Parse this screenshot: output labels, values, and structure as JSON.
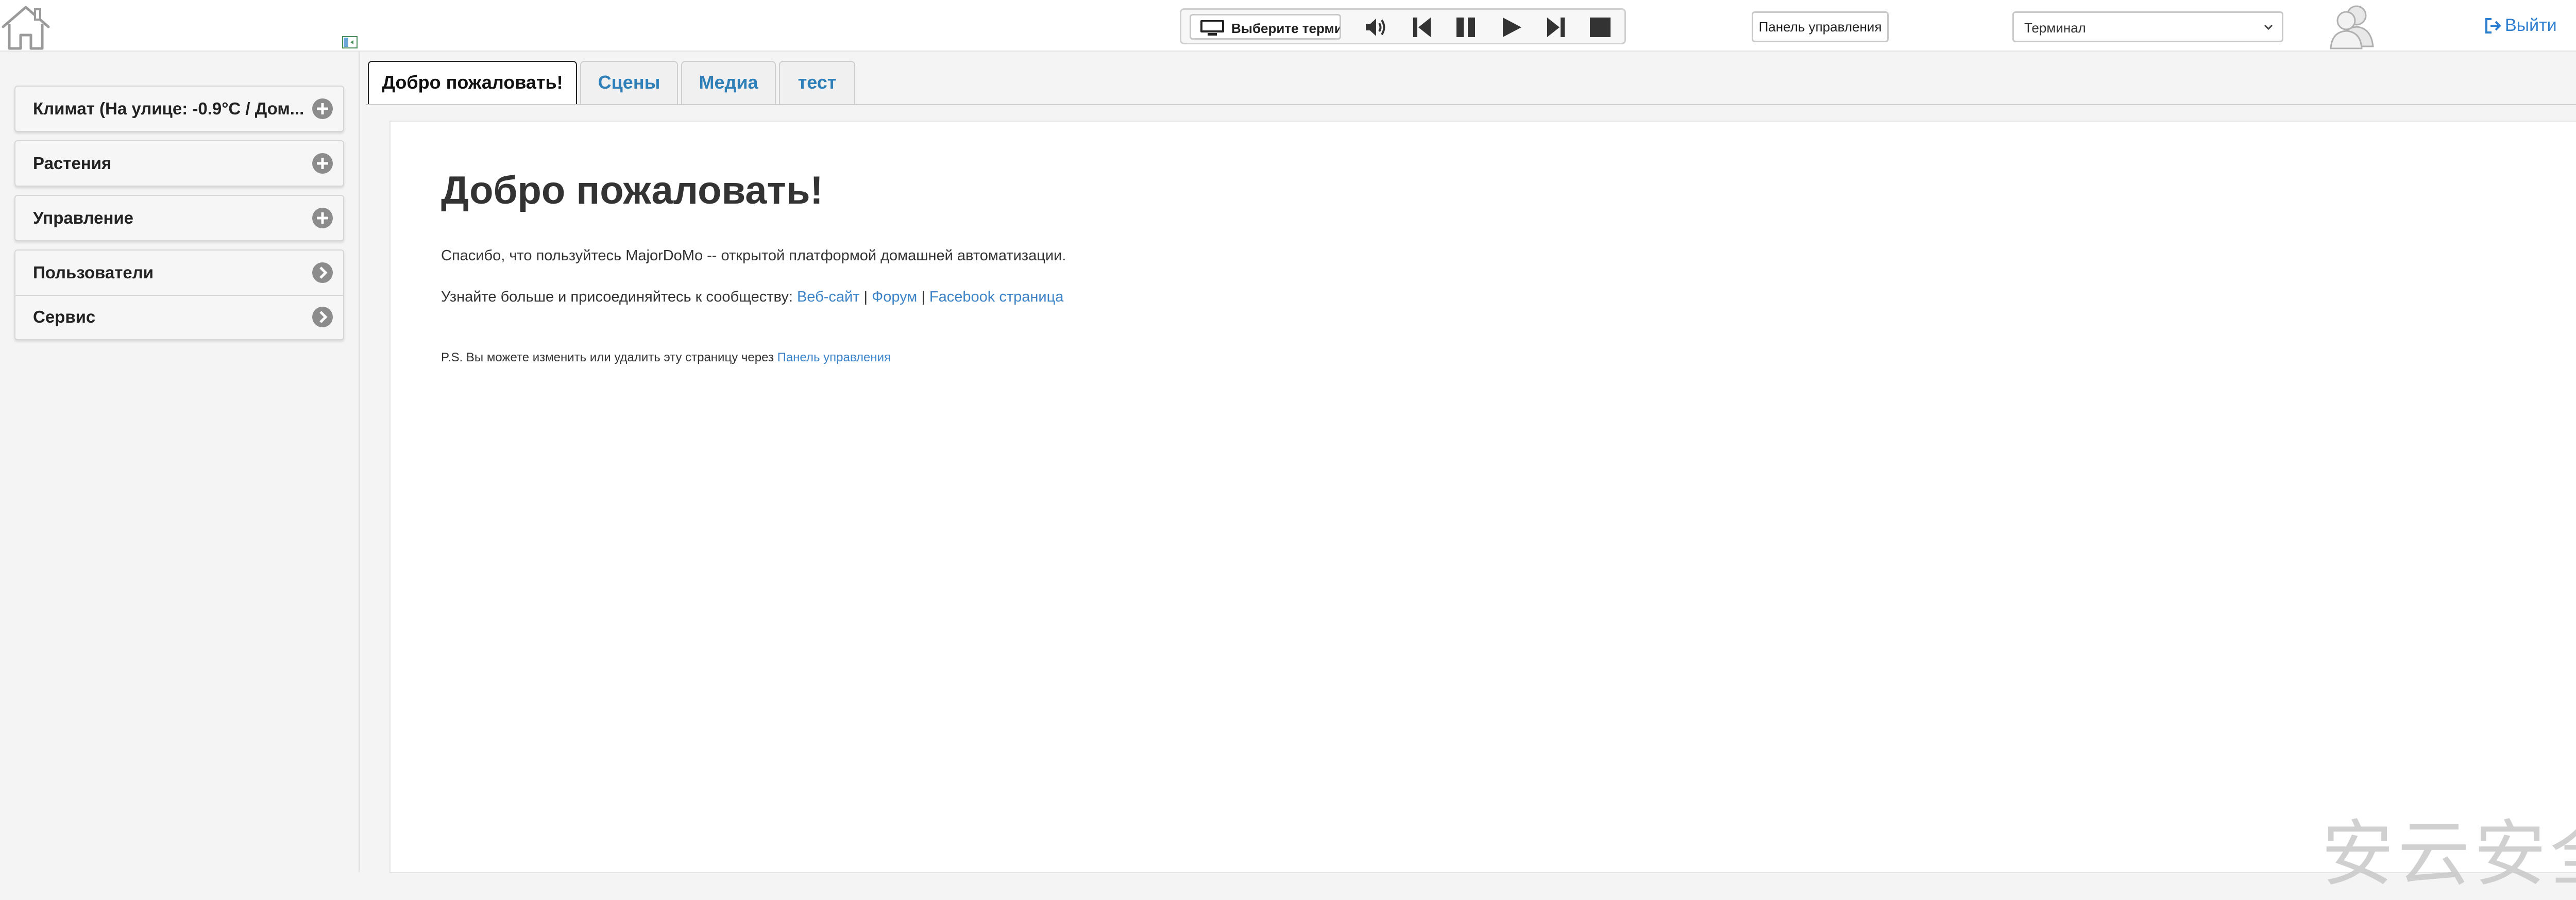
{
  "header": {
    "home_icon": "home-outline-icon",
    "sidebar_toggle_icon": "sidebar-toggle-icon",
    "player": {
      "terminal_button_label": "Выберите терми",
      "monitor_icon": "monitor-icon",
      "controls": [
        "volume-icon",
        "previous-icon",
        "pause-icon",
        "play-icon",
        "next-icon",
        "stop-icon"
      ]
    },
    "control_panel_label": "Панель управления",
    "terminal_select_value": "Терминал",
    "users_icon": "users-icon",
    "logout_label": "Выйти",
    "accent_color": "#2f7fd0"
  },
  "sidebar": {
    "items": [
      {
        "label": "Климат (На улице: -0.9°C / Дом...",
        "icon": "plus-circle-icon"
      },
      {
        "label": "Растения",
        "icon": "plus-circle-icon"
      },
      {
        "label": "Управление",
        "icon": "plus-circle-icon"
      },
      {
        "label": "Пользователи",
        "icon": "chevron-right-circle-icon"
      },
      {
        "label": "Сервис",
        "icon": "chevron-right-circle-icon"
      }
    ]
  },
  "main": {
    "tabs": [
      {
        "label": "Добро пожаловать!",
        "active": true
      },
      {
        "label": "Сцены",
        "active": false
      },
      {
        "label": "Медиа",
        "active": false
      },
      {
        "label": "тест",
        "active": false
      }
    ],
    "title": "Добро пожаловать!",
    "intro": "Спасибо, что пользуйтесь MajorDoMo -- открытой платформой домашней автоматизации.",
    "community_prefix": "Узнайте больше и присоединяйтесь к сообществу:",
    "links": {
      "website": "Веб-сайт",
      "forum": "Форум",
      "facebook": "Facebook страница",
      "separator": "|"
    },
    "ps_text": "P.S. Вы можете изменить или удалить эту страницу через",
    "ps_link": "Панель управления"
  },
  "watermark": "安云安全"
}
